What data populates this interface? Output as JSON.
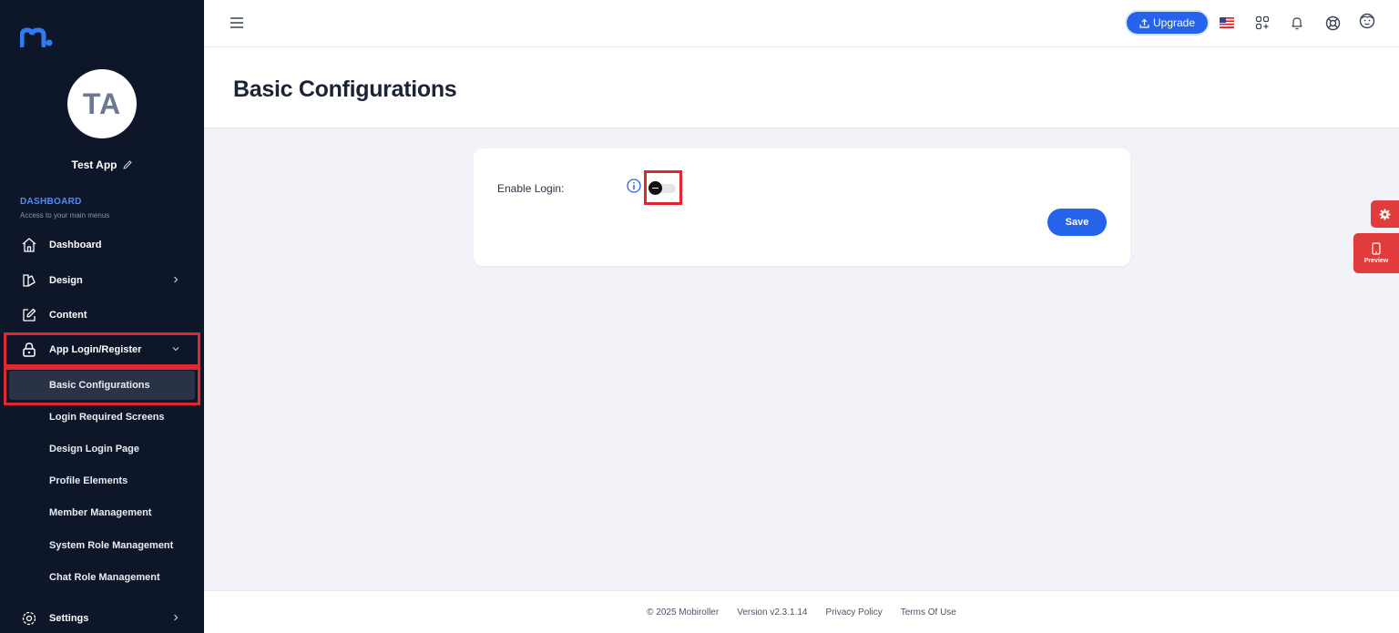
{
  "app": {
    "initials": "TA",
    "name": "Test App"
  },
  "sidebar": {
    "section_title": "DASHBOARD",
    "section_sub": "Access to your main menus",
    "items": [
      {
        "label": "Dashboard"
      },
      {
        "label": "Design"
      },
      {
        "label": "Content"
      },
      {
        "label": "App Login/Register"
      },
      {
        "label": "Settings"
      }
    ],
    "sub_items": [
      {
        "label": "Basic Configurations"
      },
      {
        "label": "Login Required Screens"
      },
      {
        "label": "Design Login Page"
      },
      {
        "label": "Profile Elements"
      },
      {
        "label": "Member Management"
      },
      {
        "label": "System Role Management"
      },
      {
        "label": "Chat Role Management"
      }
    ]
  },
  "header": {
    "upgrade_label": "Upgrade"
  },
  "page": {
    "title": "Basic Configurations"
  },
  "form": {
    "enable_login_label": "Enable Login:",
    "enable_login_on": false,
    "save_label": "Save"
  },
  "floating": {
    "preview_label": "Preview"
  },
  "footer": {
    "copyright": "© 2025 Mobiroller",
    "version": "Version v2.3.1.14",
    "privacy": "Privacy Policy",
    "terms": "Terms Of Use"
  },
  "colors": {
    "accent": "#2563eb",
    "sidebar_bg": "#0e1729",
    "highlight": "#e0262e",
    "floating": "#e23b3b"
  }
}
